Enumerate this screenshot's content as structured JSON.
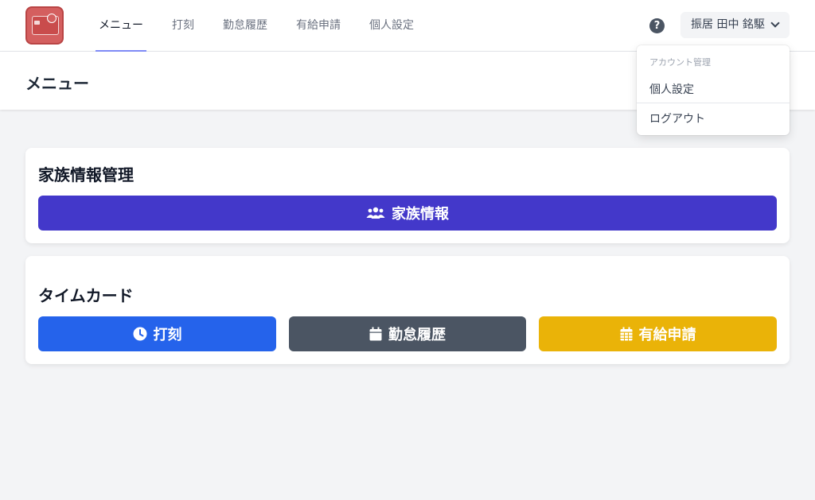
{
  "colors": {
    "primary": "#4338ca",
    "punch": "#2563eb",
    "history": "#4b5563",
    "leave": "#eab308",
    "logo": "#d45f5f",
    "active_tab_underline": "#818cf8"
  },
  "nav": {
    "tabs": [
      {
        "label": "メニュー",
        "active": true
      },
      {
        "label": "打刻"
      },
      {
        "label": "勤怠履歴"
      },
      {
        "label": "有給申請"
      },
      {
        "label": "個人設定"
      }
    ],
    "help_icon": "?",
    "user_name": "振居 田中 銘駆"
  },
  "dropdown": {
    "heading": "アカウント管理",
    "items": [
      {
        "label": "個人設定"
      },
      {
        "label": "ログアウト"
      }
    ]
  },
  "header": {
    "title": "メニュー"
  },
  "family_panel": {
    "title": "家族情報管理",
    "button_label": "家族情報",
    "button_icon": "users-icon"
  },
  "timecard_panel": {
    "title": "タイムカード",
    "buttons": [
      {
        "label": "打刻",
        "icon": "clock-icon"
      },
      {
        "label": "勤怠履歴",
        "icon": "calendar-icon"
      },
      {
        "label": "有給申請",
        "icon": "calendar-grid-icon"
      }
    ]
  }
}
